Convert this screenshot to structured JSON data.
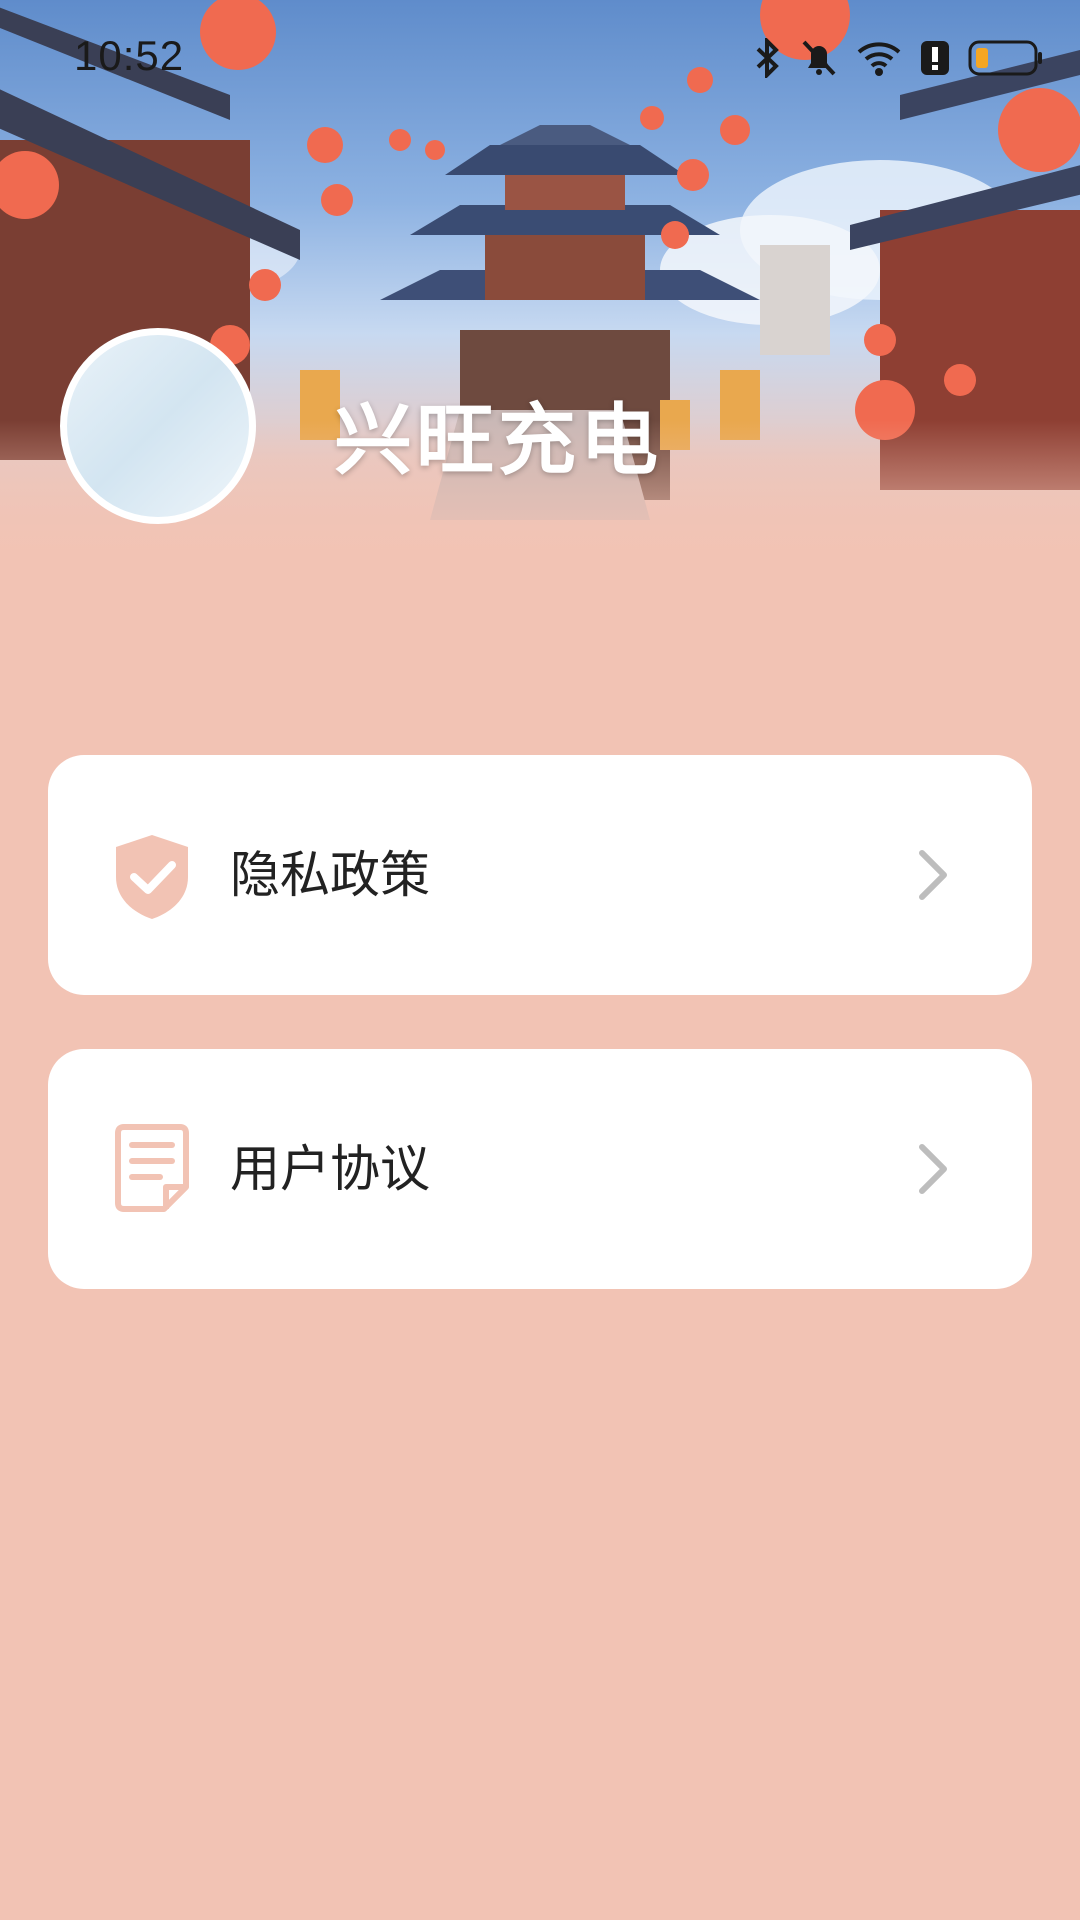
{
  "status_bar": {
    "time": "10:52",
    "icons": [
      "bluetooth-icon",
      "mute-bell-icon",
      "wifi-icon",
      "alert-icon",
      "battery-icon"
    ]
  },
  "profile": {
    "app_name": "兴旺充电"
  },
  "menu": {
    "items": [
      {
        "label": "隐私政策",
        "icon": "shield-check-icon"
      },
      {
        "label": "用户协议",
        "icon": "document-icon"
      }
    ]
  },
  "colors": {
    "background": "#F2C3B4",
    "card": "#ffffff",
    "accent": "#F2C3B4",
    "text": "#222222",
    "chevron": "#BDBDBD"
  }
}
